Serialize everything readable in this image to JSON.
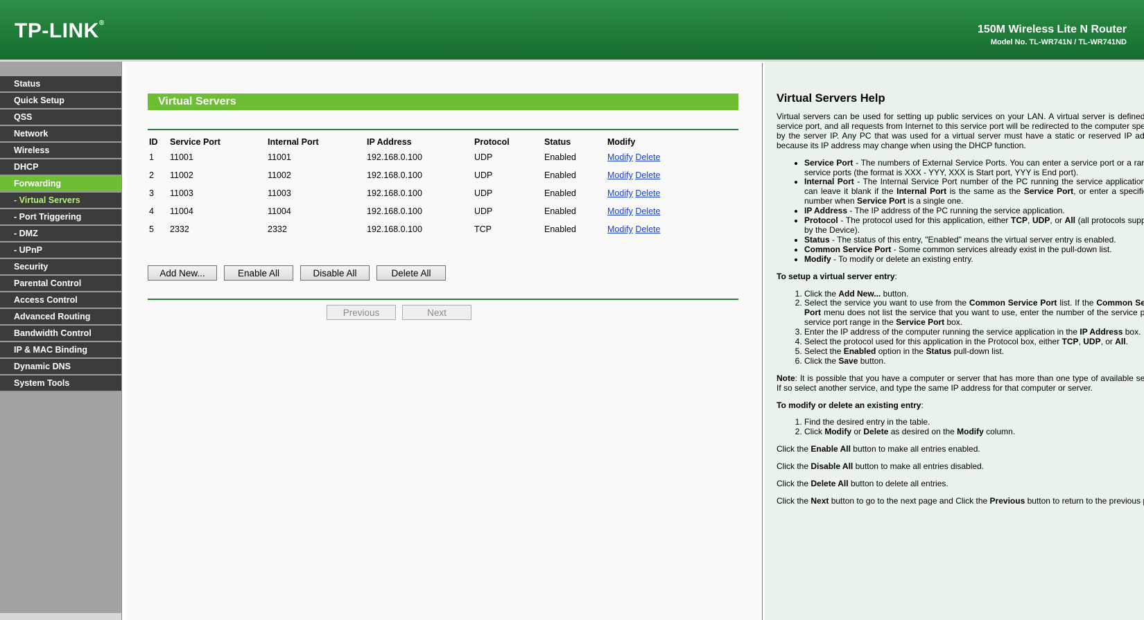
{
  "header": {
    "logo": "TP-LINK",
    "logo_mark": "®",
    "product": "150M Wireless Lite N Router",
    "model": "Model No. TL-WR741N / TL-WR741ND"
  },
  "menu": [
    {
      "label": "Status"
    },
    {
      "label": "Quick Setup"
    },
    {
      "label": "QSS"
    },
    {
      "label": "Network"
    },
    {
      "label": "Wireless"
    },
    {
      "label": "DHCP"
    },
    {
      "label": "Forwarding"
    },
    {
      "label": "- Virtual Servers"
    },
    {
      "label": "- Port Triggering"
    },
    {
      "label": "- DMZ"
    },
    {
      "label": "- UPnP"
    },
    {
      "label": "Security"
    },
    {
      "label": "Parental Control"
    },
    {
      "label": "Access Control"
    },
    {
      "label": "Advanced Routing"
    },
    {
      "label": "Bandwidth Control"
    },
    {
      "label": "IP & MAC Binding"
    },
    {
      "label": "Dynamic DNS"
    },
    {
      "label": "System Tools"
    }
  ],
  "main": {
    "title": "Virtual Servers",
    "columns": [
      "ID",
      "Service Port",
      "Internal Port",
      "IP Address",
      "Protocol",
      "Status",
      "Modify"
    ],
    "rows": [
      {
        "id": "1",
        "service_port": "11001",
        "internal_port": "11001",
        "ip": "192.168.0.100",
        "protocol": "UDP",
        "status": "Enabled",
        "modify": "Modify",
        "delete": "Delete"
      },
      {
        "id": "2",
        "service_port": "11002",
        "internal_port": "11002",
        "ip": "192.168.0.100",
        "protocol": "UDP",
        "status": "Enabled",
        "modify": "Modify",
        "delete": "Delete"
      },
      {
        "id": "3",
        "service_port": "11003",
        "internal_port": "11003",
        "ip": "192.168.0.100",
        "protocol": "UDP",
        "status": "Enabled",
        "modify": "Modify",
        "delete": "Delete"
      },
      {
        "id": "4",
        "service_port": "11004",
        "internal_port": "11004",
        "ip": "192.168.0.100",
        "protocol": "UDP",
        "status": "Enabled",
        "modify": "Modify",
        "delete": "Delete"
      },
      {
        "id": "5",
        "service_port": "2332",
        "internal_port": "2332",
        "ip": "192.168.0.100",
        "protocol": "TCP",
        "status": "Enabled",
        "modify": "Modify",
        "delete": "Delete"
      }
    ],
    "buttons": {
      "add_new": "Add New...",
      "enable_all": "Enable All",
      "disable_all": "Disable All",
      "delete_all": "Delete All",
      "previous": "Previous",
      "next": "Next"
    }
  },
  "help": {
    "title": "Virtual Servers Help",
    "intro": "Virtual servers can be used for setting up public services on your LAN. A virtual server is defined as a service port, and all requests from Internet to this service port will be redirected to the computer specified by the server IP. Any PC that was used for a virtual server must have a static or reserved IP address because its IP address may change when using the DHCP function.",
    "fields": [
      {
        "term": "Service Port",
        "desc": " - The numbers of External Service Ports. You can enter a service port or a range of service ports (the format is XXX - YYY, XXX is Start port, YYY is End port)."
      },
      {
        "term": "Internal Port",
        "desc_a": " - The Internal Service Port number of the PC running the service application. You can leave it blank if the ",
        "term_b": "Internal Port",
        "desc_b": " is the same as the ",
        "term_c": "Service Port",
        "desc_c": ", or enter a specific port number when ",
        "term_d": "Service Port",
        "desc_d": " is a single one."
      },
      {
        "term": "IP Address",
        "desc": " - The IP address of the PC running the service application."
      },
      {
        "term": "Protocol",
        "desc_a": " - The protocol used for this application, either ",
        "t1": "TCP",
        "sep1": ", ",
        "t2": "UDP",
        "sep2": ", or ",
        "t3": "All",
        "desc_b": " (all protocols supported by the Device)."
      },
      {
        "term": "Status",
        "desc": " - The status of this entry, \"Enabled\" means the virtual server entry is enabled."
      },
      {
        "term": "Common Service Port",
        "desc": " - Some common services already exist in the pull-down list."
      },
      {
        "term": "Modify",
        "desc": " - To modify or delete an existing entry."
      }
    ],
    "setup_heading": "To setup a virtual server entry",
    "setup_steps": {
      "s1a": "Click the ",
      "s1b": "Add New...",
      "s1c": " button.",
      "s2a": "Select the service you want to use from the ",
      "s2b": "Common Service Port",
      "s2c": " list. If the ",
      "s2d": "Common Service Port",
      "s2e": " menu does not list the service that you want to use, enter the number of the service port or service port range in the ",
      "s2f": "Service Port",
      "s2g": " box.",
      "s3a": "Enter the IP address of the computer running the service application in the ",
      "s3b": "IP Address",
      "s3c": " box.",
      "s4a": "Select the protocol used for this application in the Protocol box, either ",
      "s4b": "TCP",
      "s4c": ", ",
      "s4d": "UDP",
      "s4e": ", or ",
      "s4f": "All",
      "s4g": ".",
      "s5a": "Select the ",
      "s5b": "Enabled",
      "s5c": " option in the ",
      "s5d": "Status",
      "s5e": " pull-down list.",
      "s6a": "Click the ",
      "s6b": "Save",
      "s6c": " button."
    },
    "note_label": "Note",
    "note_text": ": It is possible that you have a computer or server that has more than one type of available service. If so select another service, and type the same IP address for that computer or server.",
    "modify_heading": "To modify or delete an existing entry",
    "modify_steps": {
      "m1": "Find the desired entry in the table.",
      "m2a": "Click ",
      "m2b": "Modify",
      "m2c": " or ",
      "m2d": "Delete",
      "m2e": " as desired on the ",
      "m2f": "Modify",
      "m2g": " column."
    },
    "enable_line": {
      "a": "Click the ",
      "b": "Enable All",
      "c": " button to make all entries enabled."
    },
    "disable_line": {
      "a": "Click the ",
      "b": "Disable All",
      "c": " button to make all entries disabled."
    },
    "delete_line": {
      "a": "Click the ",
      "b": "Delete All",
      "c": " button to delete all entries."
    },
    "next_line": {
      "a": "Click the ",
      "b": "Next",
      "c": " button to go to the next page and Click the ",
      "d": "Previous",
      "e": " button to return to the previous page."
    }
  }
}
